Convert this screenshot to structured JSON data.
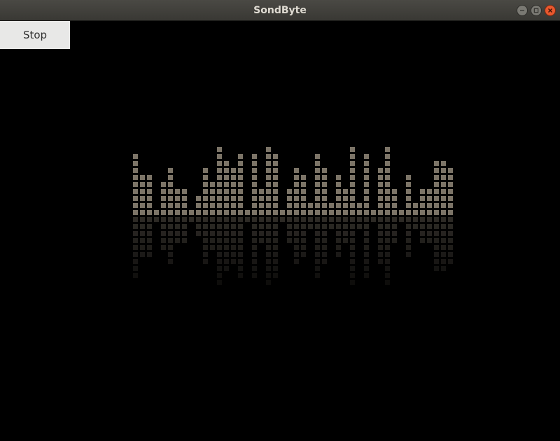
{
  "window": {
    "title": "SondByte"
  },
  "controls": {
    "stop_label": "Stop"
  },
  "icons": {
    "minimize": "minimize-icon",
    "maximize": "maximize-icon",
    "close": "close-icon"
  },
  "visualizer": {
    "cell_color": "#7c7467",
    "reflection_color": "#7c7467",
    "bar_levels": [
      9,
      6,
      6,
      1,
      5,
      7,
      4,
      4,
      1,
      3,
      7,
      5,
      10,
      8,
      7,
      9,
      1,
      9,
      4,
      10,
      9,
      1,
      4,
      7,
      6,
      2,
      9,
      7,
      2,
      6,
      4,
      10,
      2,
      9,
      1,
      7,
      10,
      4,
      1,
      6,
      2,
      4,
      4,
      8,
      8,
      7
    ]
  }
}
